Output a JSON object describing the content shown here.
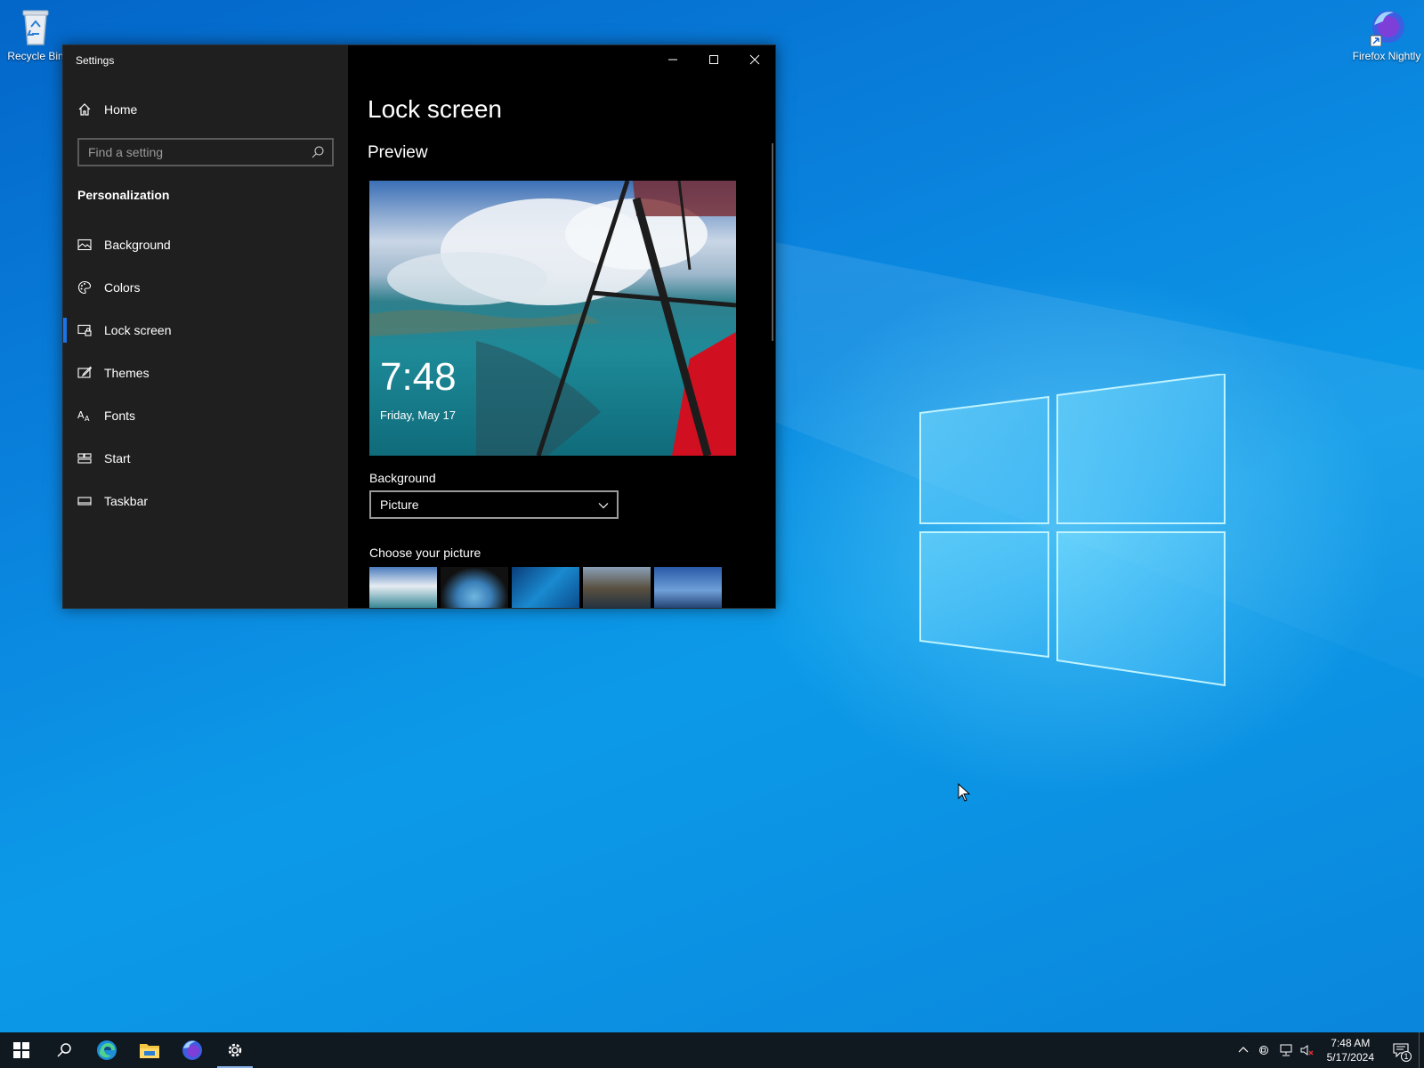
{
  "desktop": {
    "icons": [
      {
        "label": "Recycle Bin",
        "icon": "recycle-bin-icon"
      },
      {
        "label": "Firefox Nightly",
        "icon": "firefox-nightly-icon"
      }
    ]
  },
  "window": {
    "title": "Settings",
    "nav": {
      "home_label": "Home",
      "search_placeholder": "Find a setting",
      "section": "Personalization",
      "items": [
        {
          "label": "Background",
          "icon": "picture-icon",
          "active": false
        },
        {
          "label": "Colors",
          "icon": "palette-icon",
          "active": false
        },
        {
          "label": "Lock screen",
          "icon": "lock-screen-icon",
          "active": true
        },
        {
          "label": "Themes",
          "icon": "brush-icon",
          "active": false
        },
        {
          "label": "Fonts",
          "icon": "font-icon",
          "active": false
        },
        {
          "label": "Start",
          "icon": "start-layout-icon",
          "active": false
        },
        {
          "label": "Taskbar",
          "icon": "taskbar-icon",
          "active": false
        }
      ]
    },
    "content": {
      "page_title": "Lock screen",
      "preview_title": "Preview",
      "preview_time": "7:48",
      "preview_date": "Friday, May 17",
      "background_label": "Background",
      "background_value": "Picture",
      "choose_label": "Choose your picture"
    }
  },
  "taskbar": {
    "apps": [
      "start-icon",
      "search-icon",
      "edge-icon",
      "file-explorer-icon",
      "firefox-nightly-icon",
      "settings-gear-icon"
    ],
    "time": "7:48 AM",
    "date": "5/17/2024",
    "notification_count": "1"
  },
  "colors": {
    "accent": "#1a73e8",
    "desktop_blue": "#0a84de",
    "nav_bg": "#1f1f1f",
    "content_bg": "#000000"
  }
}
